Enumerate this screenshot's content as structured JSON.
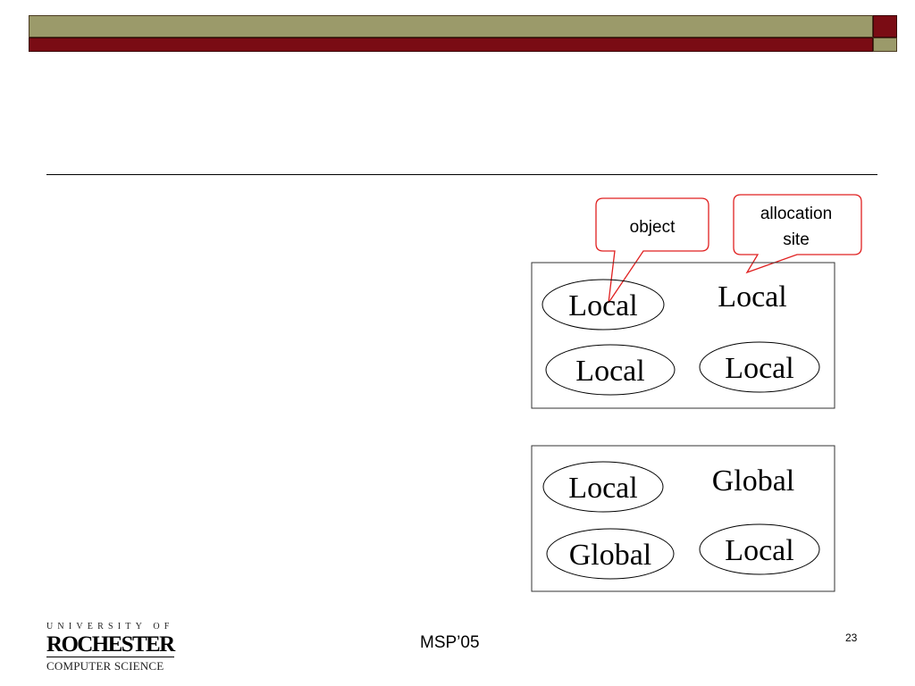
{
  "callouts": {
    "object": "object",
    "allocation_line1": "allocation",
    "allocation_line2": "site"
  },
  "box_top": {
    "ellipse_1": "Local",
    "plain_label": "Local",
    "ellipse_2": "Local",
    "ellipse_3": "Local"
  },
  "box_bottom": {
    "ellipse_1": "Local",
    "plain_label": "Global",
    "ellipse_2": "Global",
    "ellipse_3": "Local"
  },
  "footer": {
    "logo_top": "UNIVERSITY OF",
    "logo_main": "ROCHESTER",
    "logo_bottom": "COMPUTER SCIENCE",
    "center": "MSP’05",
    "slide_number": "23"
  },
  "colors": {
    "band_olive": "#9b9a6a",
    "band_maroon": "#7a0c14",
    "callout_border": "#e02020"
  }
}
